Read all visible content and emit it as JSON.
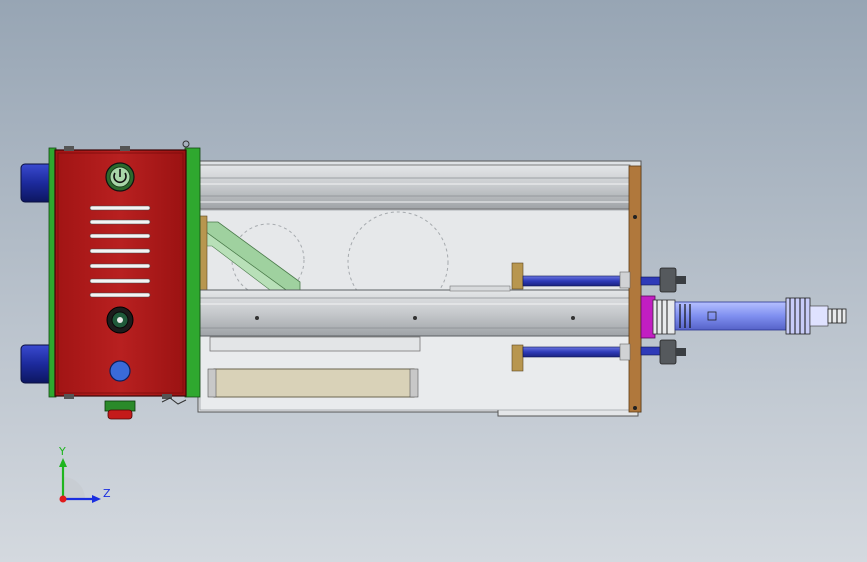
{
  "view": {
    "type": "cad-model-viewport",
    "background_top": "#97a5b4",
    "background_bottom": "#d4d9df"
  },
  "triad": {
    "y_label": "Y",
    "z_label": "Z",
    "y_color": "#1fb51f",
    "z_color": "#1a2ee0",
    "origin_color": "#e01a1a"
  },
  "palette": {
    "housing_red": "#b11c1c",
    "flange_green": "#2fa82f",
    "cylinder_blue": "#1c2a9c",
    "rail_gray": "#cfd2d4",
    "bracket_green": "#9fd19f",
    "end_plate_brown": "#b0783c",
    "magenta_block": "#c21ec2",
    "spindle_blue": "#7f8ff0"
  },
  "housing": {
    "vent_slot_count": 6,
    "icons": [
      "power-switch-icon",
      "key-switch-icon",
      "blue-indicator-icon"
    ]
  }
}
